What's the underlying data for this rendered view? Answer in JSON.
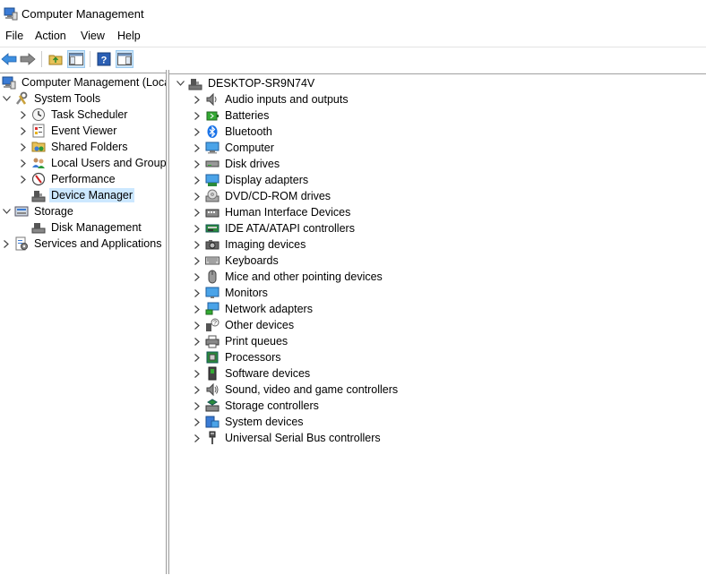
{
  "window": {
    "title": "Computer Management"
  },
  "menu": {
    "file": "File",
    "action": "Action",
    "view": "View",
    "help": "Help"
  },
  "tree": {
    "root": "Computer Management (Local",
    "system_tools": "System Tools",
    "task_scheduler": "Task Scheduler",
    "event_viewer": "Event Viewer",
    "shared_folders": "Shared Folders",
    "local_users": "Local Users and Groups",
    "performance": "Performance",
    "device_manager": "Device Manager",
    "storage": "Storage",
    "disk_management": "Disk Management",
    "services": "Services and Applications"
  },
  "devices": {
    "computer_name": "DESKTOP-SR9N74V",
    "categories": [
      {
        "label": "Audio inputs and outputs",
        "icon": "speaker-icon"
      },
      {
        "label": "Batteries",
        "icon": "battery-icon"
      },
      {
        "label": "Bluetooth",
        "icon": "bluetooth-icon"
      },
      {
        "label": "Computer",
        "icon": "computer-icon"
      },
      {
        "label": "Disk drives",
        "icon": "disk-drive-icon"
      },
      {
        "label": "Display adapters",
        "icon": "display-adapter-icon"
      },
      {
        "label": "DVD/CD-ROM drives",
        "icon": "dvd-icon"
      },
      {
        "label": "Human Interface Devices",
        "icon": "hid-icon"
      },
      {
        "label": "IDE ATA/ATAPI controllers",
        "icon": "ide-icon"
      },
      {
        "label": "Imaging devices",
        "icon": "camera-icon"
      },
      {
        "label": "Keyboards",
        "icon": "keyboard-icon"
      },
      {
        "label": "Mice and other pointing devices",
        "icon": "mouse-icon"
      },
      {
        "label": "Monitors",
        "icon": "monitor-icon"
      },
      {
        "label": "Network adapters",
        "icon": "network-icon"
      },
      {
        "label": "Other devices",
        "icon": "unknown-device-icon"
      },
      {
        "label": "Print queues",
        "icon": "printer-icon"
      },
      {
        "label": "Processors",
        "icon": "processor-icon"
      },
      {
        "label": "Software devices",
        "icon": "software-device-icon"
      },
      {
        "label": "Sound, video and game controllers",
        "icon": "sound-icon"
      },
      {
        "label": "Storage controllers",
        "icon": "storage-controller-icon"
      },
      {
        "label": "System devices",
        "icon": "system-devices-icon"
      },
      {
        "label": "Universal Serial Bus controllers",
        "icon": "usb-icon"
      }
    ]
  },
  "colors": {
    "selection": "#cce8ff",
    "accent": "#0078d7"
  }
}
